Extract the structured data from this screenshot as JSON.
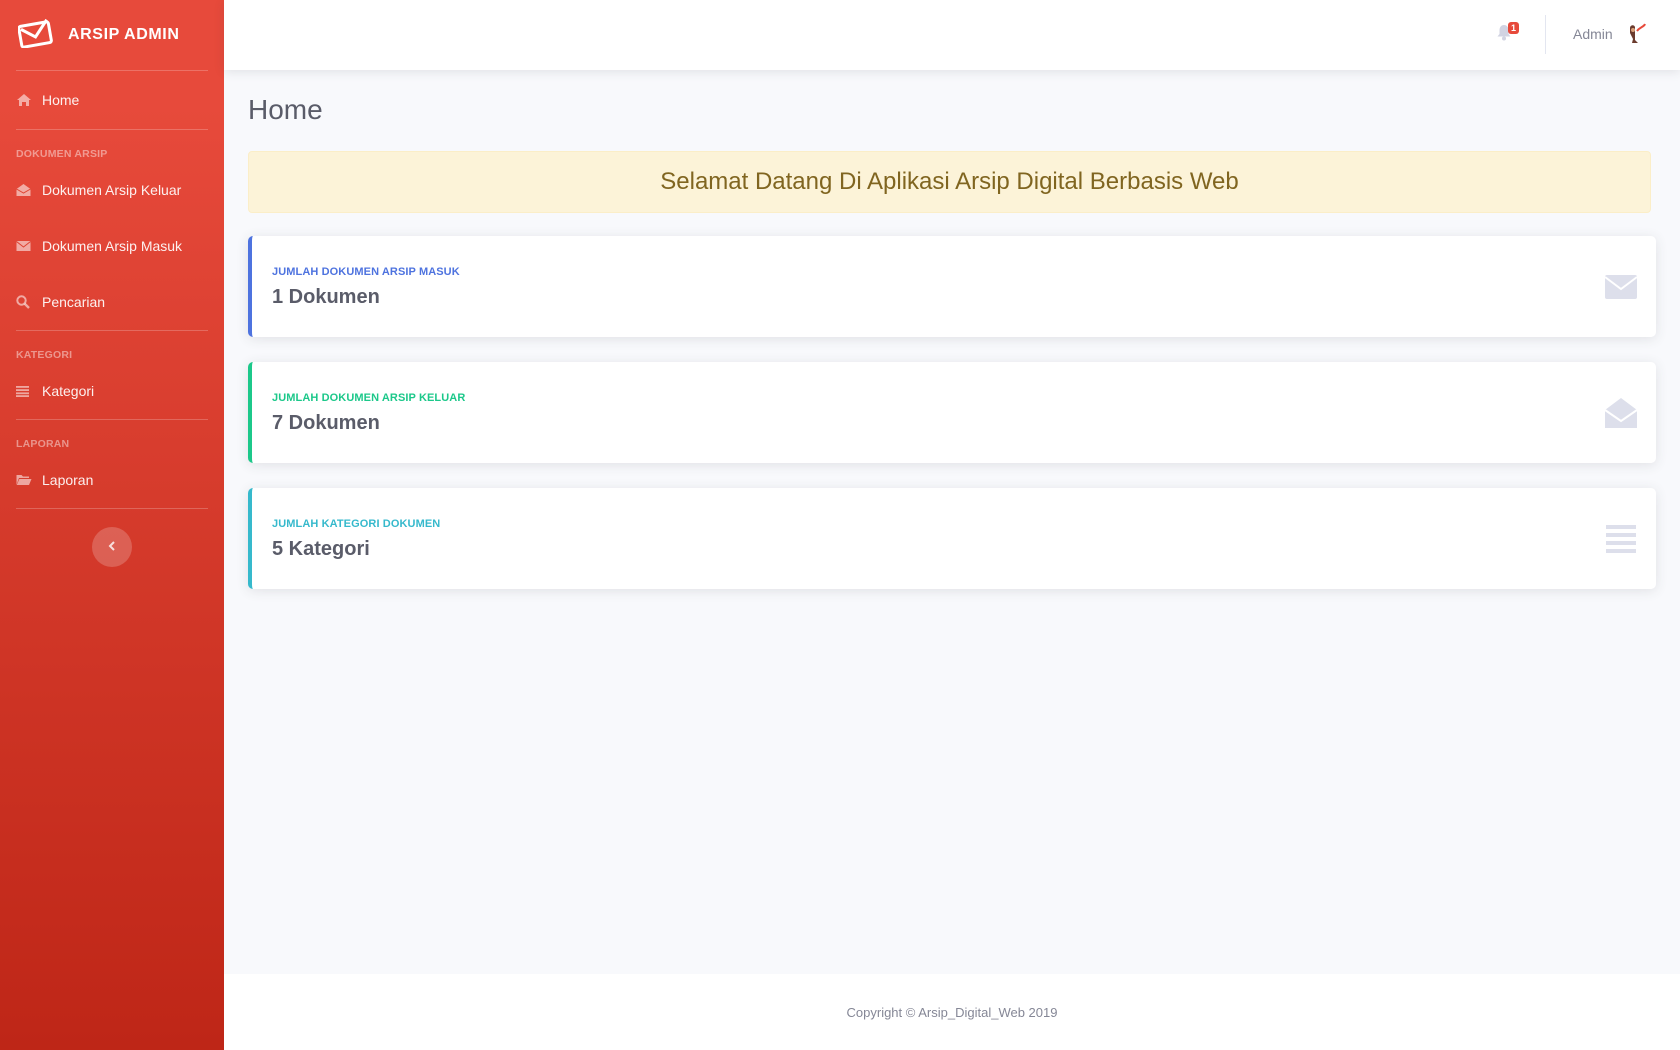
{
  "brand": {
    "title": "ARSIP ADMIN",
    "icon": "envelope-icon"
  },
  "sidebar": {
    "home": {
      "label": "Home",
      "icon": "home-icon"
    },
    "sections": [
      {
        "heading": "DOKUMEN ARSIP",
        "items": [
          {
            "label": "Dokumen Arsip Keluar",
            "icon": "envelope-open-icon"
          },
          {
            "label": "Dokumen Arsip Masuk",
            "icon": "envelope-icon"
          },
          {
            "label": "Pencarian",
            "icon": "search-icon"
          }
        ]
      },
      {
        "heading": "KATEGORI",
        "items": [
          {
            "label": "Kategori",
            "icon": "list-icon"
          }
        ]
      },
      {
        "heading": "LAPORAN",
        "items": [
          {
            "label": "Laporan",
            "icon": "folder-open-icon"
          }
        ]
      }
    ],
    "toggle_icon": "chevron-left-icon"
  },
  "topbar": {
    "notification_count": "1",
    "notification_icon": "bell-icon",
    "user_name": "Admin"
  },
  "main": {
    "title": "Home",
    "welcome": "Selamat Datang Di Aplikasi Arsip Digital Berbasis Web",
    "cards": [
      {
        "label": "JUMLAH DOKUMEN ARSIP MASUK",
        "value": "1 Dokumen",
        "icon": "envelope-icon",
        "color": "#4e73df"
      },
      {
        "label": "JUMLAH DOKUMEN ARSIP KELUAR",
        "value": "7 Dokumen",
        "icon": "envelope-open-icon",
        "color": "#1cc88a"
      },
      {
        "label": "JUMLAH KATEGORI DOKUMEN",
        "value": "5 Kategori",
        "icon": "list-icon",
        "color": "#36b9cc"
      }
    ]
  },
  "footer": {
    "copyright": "Copyright © Arsip_Digital_Web 2019"
  },
  "colors": {
    "sidebar_start": "#e74a3b",
    "sidebar_end": "#be2617",
    "background": "#f8f9fc",
    "welcome_bg": "#fcf3d8",
    "welcome_text": "#806520"
  }
}
